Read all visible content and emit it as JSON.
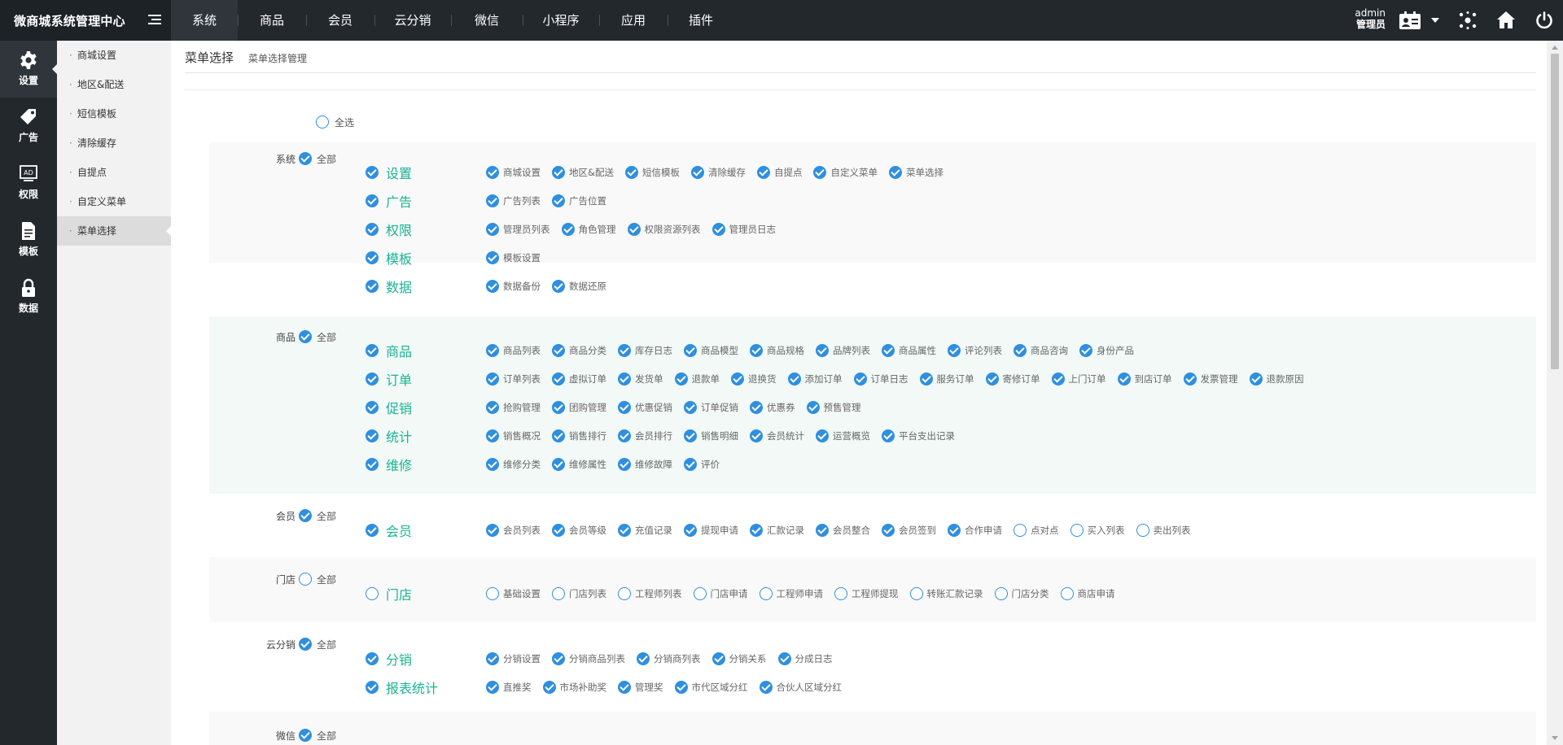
{
  "app": {
    "title": "微商城系统管理中心"
  },
  "topnav": [
    "系统",
    "商品",
    "会员",
    "云分销",
    "微信",
    "小程序",
    "应用",
    "插件"
  ],
  "user": {
    "name": "admin",
    "role": "管理员"
  },
  "iconbar": [
    {
      "label": "设置",
      "icon": "gear-icon"
    },
    {
      "label": "广告",
      "icon": "tag-icon"
    },
    {
      "label": "权限",
      "icon": "ad-screen-icon"
    },
    {
      "label": "模板",
      "icon": "document-icon"
    },
    {
      "label": "数据",
      "icon": "lock-icon"
    }
  ],
  "subbar": [
    "商城设置",
    "地区&配送",
    "短信模板",
    "清除缓存",
    "自提点",
    "自定义菜单",
    "菜单选择"
  ],
  "page": {
    "title": "菜单选择",
    "subtitle": "菜单选择管理",
    "select_all": "全选",
    "all_label": "全部"
  },
  "groups": [
    {
      "name": "系统",
      "checked": true,
      "rows": [
        {
          "label": "设置",
          "checked": true,
          "options": [
            {
              "text": "商城设置",
              "checked": true
            },
            {
              "text": "地区&配送",
              "checked": true
            },
            {
              "text": "短信模板",
              "checked": true
            },
            {
              "text": "清除缓存",
              "checked": true
            },
            {
              "text": "自提点",
              "checked": true
            },
            {
              "text": "自定义菜单",
              "checked": true
            },
            {
              "text": "菜单选择",
              "checked": true
            }
          ]
        },
        {
          "label": "广告",
          "checked": true,
          "options": [
            {
              "text": "广告列表",
              "checked": true
            },
            {
              "text": "广告位置",
              "checked": true
            }
          ]
        },
        {
          "label": "权限",
          "checked": true,
          "options": [
            {
              "text": "管理员列表",
              "checked": true
            },
            {
              "text": "角色管理",
              "checked": true
            },
            {
              "text": "权限资源列表",
              "checked": true
            },
            {
              "text": "管理员日志",
              "checked": true
            }
          ]
        },
        {
          "label": "模板",
          "checked": true,
          "options": [
            {
              "text": "模板设置",
              "checked": true
            }
          ]
        },
        {
          "label": "数据",
          "checked": true,
          "options": [
            {
              "text": "数据备份",
              "checked": true
            },
            {
              "text": "数据还原",
              "checked": true
            }
          ]
        }
      ]
    },
    {
      "name": "商品",
      "checked": true,
      "rows": [
        {
          "label": "商品",
          "checked": true,
          "options": [
            {
              "text": "商品列表",
              "checked": true
            },
            {
              "text": "商品分类",
              "checked": true
            },
            {
              "text": "库存日志",
              "checked": true
            },
            {
              "text": "商品模型",
              "checked": true
            },
            {
              "text": "商品规格",
              "checked": true
            },
            {
              "text": "品牌列表",
              "checked": true
            },
            {
              "text": "商品属性",
              "checked": true
            },
            {
              "text": "评论列表",
              "checked": true
            },
            {
              "text": "商品咨询",
              "checked": true
            },
            {
              "text": "身份产品",
              "checked": true
            }
          ]
        },
        {
          "label": "订单",
          "checked": true,
          "options": [
            {
              "text": "订单列表",
              "checked": true
            },
            {
              "text": "虚拟订单",
              "checked": true
            },
            {
              "text": "发货单",
              "checked": true
            },
            {
              "text": "退款单",
              "checked": true
            },
            {
              "text": "退换货",
              "checked": true
            },
            {
              "text": "添加订单",
              "checked": true
            },
            {
              "text": "订单日志",
              "checked": true
            },
            {
              "text": "服务订单",
              "checked": true
            },
            {
              "text": "寄修订单",
              "checked": true
            },
            {
              "text": "上门订单",
              "checked": true
            },
            {
              "text": "到店订单",
              "checked": true
            },
            {
              "text": "发票管理",
              "checked": true
            },
            {
              "text": "退款原因",
              "checked": true
            }
          ]
        },
        {
          "label": "促销",
          "checked": true,
          "options": [
            {
              "text": "抢购管理",
              "checked": true
            },
            {
              "text": "团购管理",
              "checked": true
            },
            {
              "text": "优惠促销",
              "checked": true
            },
            {
              "text": "订单促销",
              "checked": true
            },
            {
              "text": "优惠券",
              "checked": true
            },
            {
              "text": "预售管理",
              "checked": true
            }
          ]
        },
        {
          "label": "统计",
          "checked": true,
          "options": [
            {
              "text": "销售概况",
              "checked": true
            },
            {
              "text": "销售排行",
              "checked": true
            },
            {
              "text": "会员排行",
              "checked": true
            },
            {
              "text": "销售明细",
              "checked": true
            },
            {
              "text": "会员统计",
              "checked": true
            },
            {
              "text": "运营概览",
              "checked": true
            },
            {
              "text": "平台支出记录",
              "checked": true
            }
          ]
        },
        {
          "label": "维修",
          "checked": true,
          "options": [
            {
              "text": "维修分类",
              "checked": true
            },
            {
              "text": "维修属性",
              "checked": true
            },
            {
              "text": "维修故障",
              "checked": true
            },
            {
              "text": "评价",
              "checked": true
            }
          ]
        }
      ]
    },
    {
      "name": "会员",
      "checked": true,
      "rows": [
        {
          "label": "会员",
          "checked": true,
          "options": [
            {
              "text": "会员列表",
              "checked": true
            },
            {
              "text": "会员等级",
              "checked": true
            },
            {
              "text": "充值记录",
              "checked": true
            },
            {
              "text": "提现申请",
              "checked": true
            },
            {
              "text": "汇款记录",
              "checked": true
            },
            {
              "text": "会员整合",
              "checked": true
            },
            {
              "text": "会员签到",
              "checked": true
            },
            {
              "text": "合作申请",
              "checked": true
            },
            {
              "text": "点对点",
              "checked": false
            },
            {
              "text": "买入列表",
              "checked": false
            },
            {
              "text": "卖出列表",
              "checked": false
            }
          ]
        }
      ]
    },
    {
      "name": "门店",
      "checked": false,
      "rows": [
        {
          "label": "门店",
          "checked": false,
          "options": [
            {
              "text": "基础设置",
              "checked": false
            },
            {
              "text": "门店列表",
              "checked": false
            },
            {
              "text": "工程师列表",
              "checked": false
            },
            {
              "text": "门店申请",
              "checked": false
            },
            {
              "text": "工程师申请",
              "checked": false
            },
            {
              "text": "工程师提现",
              "checked": false
            },
            {
              "text": "转账汇款记录",
              "checked": false
            },
            {
              "text": "门店分类",
              "checked": false
            },
            {
              "text": "商店申请",
              "checked": false
            }
          ]
        }
      ]
    },
    {
      "name": "云分销",
      "checked": true,
      "rows": [
        {
          "label": "分销",
          "checked": true,
          "options": [
            {
              "text": "分销设置",
              "checked": true
            },
            {
              "text": "分销商品列表",
              "checked": true
            },
            {
              "text": "分销商列表",
              "checked": true
            },
            {
              "text": "分销关系",
              "checked": true
            },
            {
              "text": "分成日志",
              "checked": true
            }
          ]
        },
        {
          "label": "报表统计",
          "checked": true,
          "options": [
            {
              "text": "直推奖",
              "checked": true
            },
            {
              "text": "市场补助奖",
              "checked": true
            },
            {
              "text": "管理奖",
              "checked": true
            },
            {
              "text": "市代区域分红",
              "checked": true
            },
            {
              "text": "合伙人区域分红",
              "checked": true
            }
          ]
        }
      ]
    },
    {
      "name": "微信",
      "checked": true,
      "rows": []
    }
  ]
}
